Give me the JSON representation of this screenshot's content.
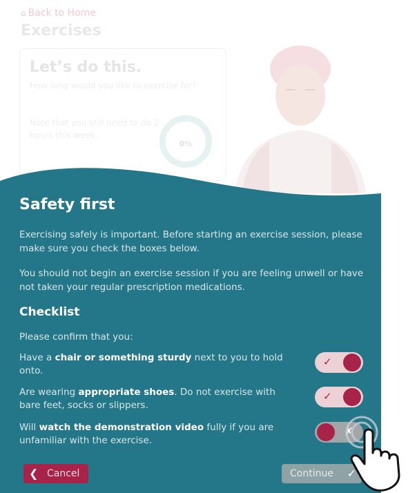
{
  "background": {
    "back_link": "Back to Home",
    "page_title": "Exercises",
    "card_title": "Let’s do this.",
    "card_question": "How long would you like to exercise for?",
    "card_note": "Note that you still need to do 2 hours this week.",
    "progress_label": "0%"
  },
  "modal": {
    "title": "Safety first",
    "intro": "Exercising safely is important. Before starting an exercise session, please make sure you check the boxes below.",
    "warning": "You should not begin an exercise session if you are feeling unwell or have not taken your regular prescription medications.",
    "checklist_title": "Checklist",
    "checklist_prompt": "Please confirm that you:",
    "items": [
      {
        "pre": "Have a ",
        "bold": "chair or something sturdy",
        "post": " next to you to hold onto.",
        "checked": true
      },
      {
        "pre": "Are wearing ",
        "bold": "appropriate shoes",
        "post": ". Do not exercise with bare feet, socks or slippers.",
        "checked": true
      },
      {
        "pre": "Will ",
        "bold": "watch the demonstration video",
        "post": " fully if you are unfamiliar with the exercise.",
        "checked": false
      }
    ],
    "toggle_on_mark": "✓",
    "toggle_off_mark": "✗"
  },
  "footer": {
    "cancel_label": "Cancel",
    "continue_label": "Continue"
  },
  "colors": {
    "panel_teal": "#247689",
    "accent_crimson": "#a8234a"
  }
}
